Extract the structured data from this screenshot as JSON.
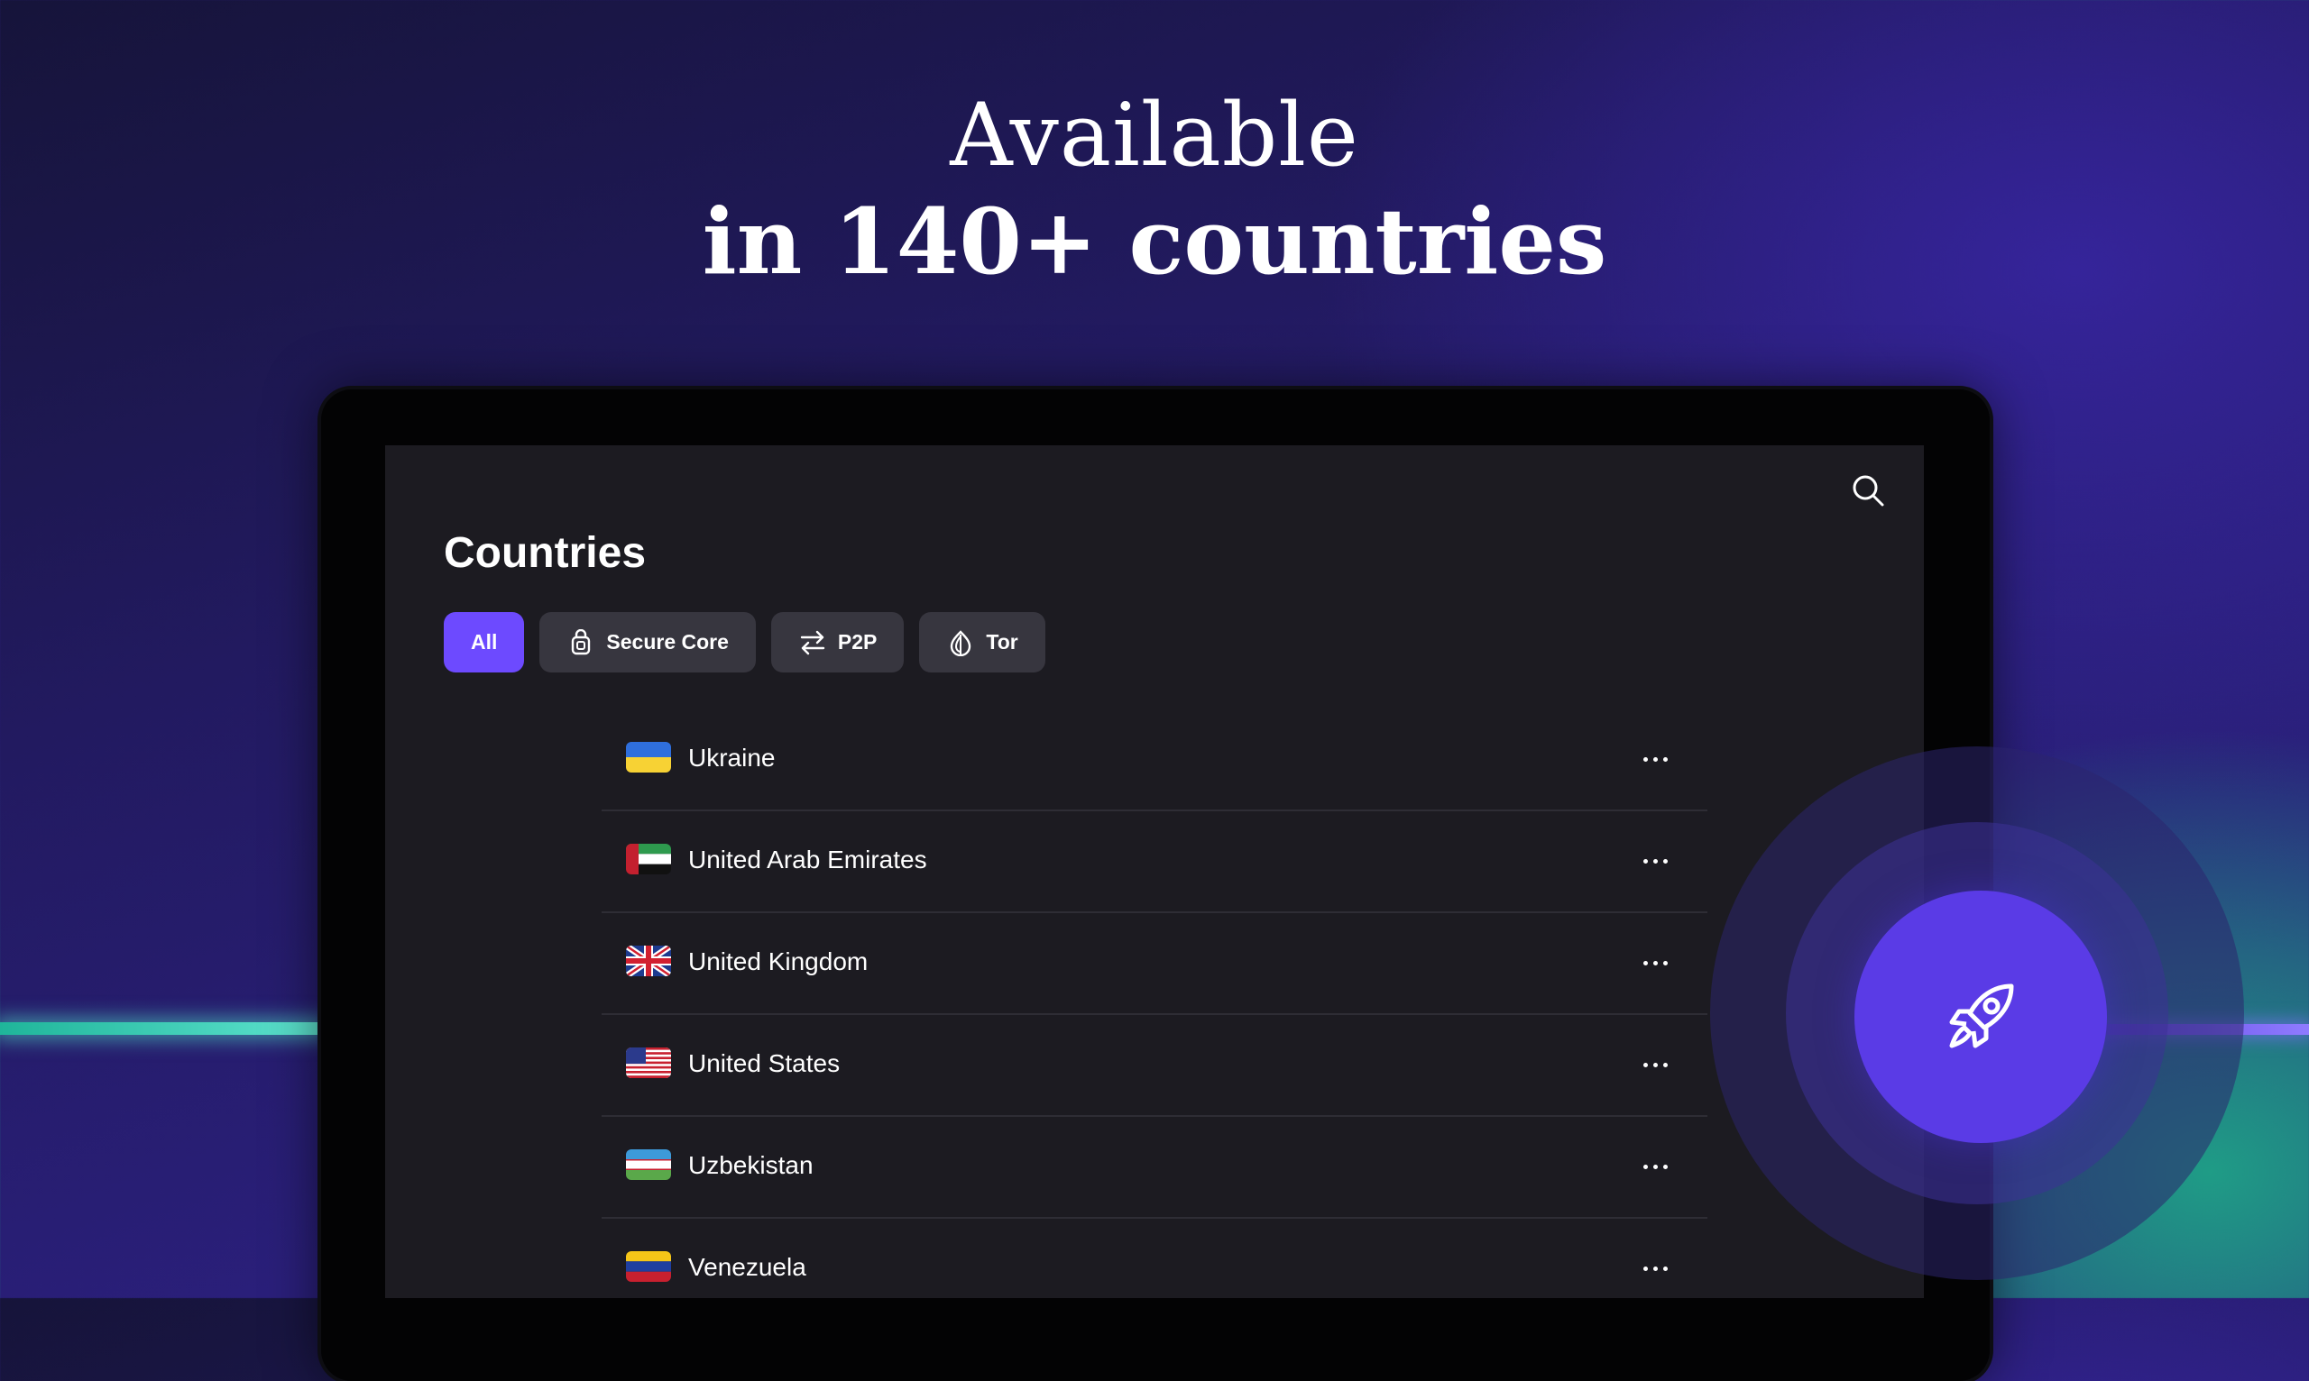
{
  "headline": {
    "line1": "Available",
    "line2": "in 140+ countries"
  },
  "screen": {
    "title": "Countries",
    "filters": [
      {
        "label": "All",
        "icon": "none",
        "active": true
      },
      {
        "label": "Secure Core",
        "icon": "secure-core-icon",
        "active": false
      },
      {
        "label": "P2P",
        "icon": "p2p-arrows-icon",
        "active": false
      },
      {
        "label": "Tor",
        "icon": "tor-onion-icon",
        "active": false
      }
    ],
    "countries": [
      {
        "name": "Ukraine",
        "flag": "ukraine-flag"
      },
      {
        "name": "United Arab Emirates",
        "flag": "uae-flag"
      },
      {
        "name": "United Kingdom",
        "flag": "uk-flag"
      },
      {
        "name": "United States",
        "flag": "us-flag"
      },
      {
        "name": "Uzbekistan",
        "flag": "uzbekistan-flag"
      },
      {
        "name": "Venezuela",
        "flag": "venezuela-flag"
      }
    ]
  },
  "fab": {
    "icon": "rocket-icon"
  },
  "colors": {
    "accent": "#6d4aff",
    "fab": "#5a3be6",
    "screen_bg": "#1c1b21",
    "chip_bg": "#37363f",
    "glow_teal": "#5ee3cf",
    "glow_purple": "#8f7bff"
  }
}
